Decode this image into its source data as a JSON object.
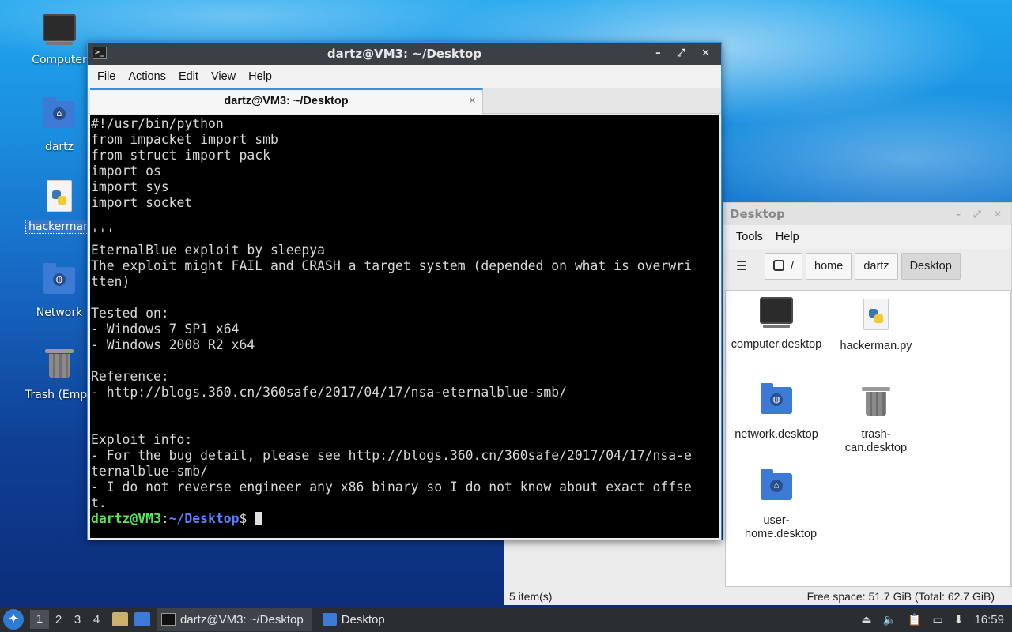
{
  "desktop": {
    "icons": [
      {
        "label": "Computer"
      },
      {
        "label": "dartz"
      },
      {
        "label": "hackerman.py"
      },
      {
        "label": "Network"
      },
      {
        "label": "Trash (Empty)"
      }
    ]
  },
  "terminal": {
    "title": "dartz@VM3: ~/Desktop",
    "menu": [
      "File",
      "Actions",
      "Edit",
      "View",
      "Help"
    ],
    "tab_label": "dartz@VM3: ~/Desktop",
    "tab_close": "×",
    "window_controls": "– ⤢ ✕",
    "lines": [
      "#!/usr/bin/python",
      "from impacket import smb",
      "from struct import pack",
      "import os",
      "import sys",
      "import socket",
      "",
      "'''",
      "EternalBlue exploit by sleepya",
      "The exploit might FAIL and CRASH a target system (depended on what is overwri",
      "tten)",
      "",
      "Tested on:",
      "- Windows 7 SP1 x64",
      "- Windows 2008 R2 x64",
      "",
      "Reference:",
      "- http://blogs.360.cn/360safe/2017/04/17/nsa-eternalblue-smb/",
      "",
      "",
      "Exploit info:"
    ],
    "bug_prefix": "- For the bug detail, please see ",
    "bug_link": "http://blogs.360.cn/360safe/2017/04/17/nsa-e",
    "lines_after": [
      "ternalblue-smb/",
      "- I do not reverse engineer any x86 binary so I do not know about exact offse",
      "t."
    ],
    "prompt_user": "dartz@VM3",
    "prompt_sep": ":",
    "prompt_path": "~/Desktop",
    "prompt_end": "$"
  },
  "filemanager": {
    "title": "Desktop",
    "menu": [
      "Tools",
      "Help"
    ],
    "breadcrumb": [
      "/",
      "home",
      "dartz",
      "Desktop"
    ],
    "items": [
      {
        "name": "computer.desktop",
        "icon": "monitor-icon"
      },
      {
        "name": "hackerman.py",
        "icon": "python-file-icon"
      },
      {
        "name": "network.desktop",
        "icon": "network-folder-icon"
      },
      {
        "name": "trash-can.desktop",
        "icon": "trash-icon"
      },
      {
        "name": "user-home.desktop",
        "icon": "home-folder-icon"
      }
    ],
    "status_count": "5 item(s)",
    "status_free": "Free space: 51.7 GiB (Total: 62.7 GiB)"
  },
  "taskbar": {
    "workspaces": [
      "1",
      "2",
      "3",
      "4"
    ],
    "tasks": [
      {
        "label": "dartz@VM3: ~/Desktop"
      },
      {
        "label": "Desktop"
      }
    ],
    "clock": "16:59"
  }
}
